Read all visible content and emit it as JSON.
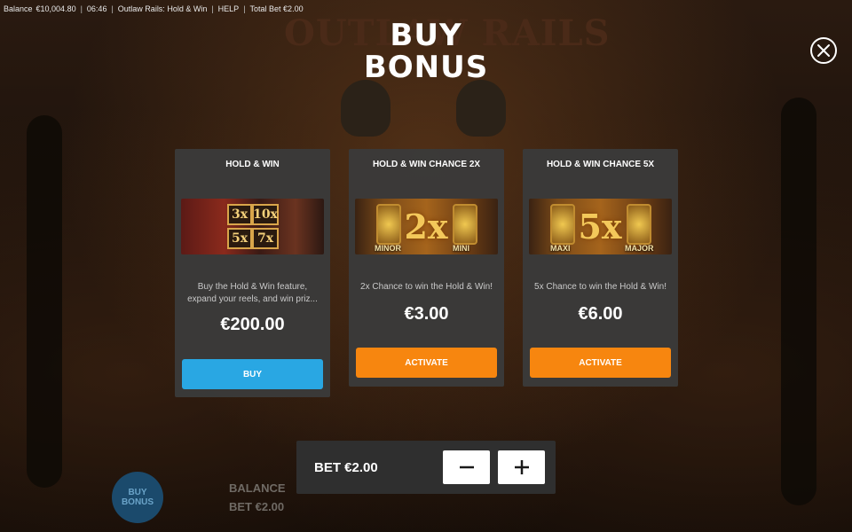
{
  "status_bar": {
    "balance_label": "Balance",
    "balance_value": "€10,004.80",
    "time": "06:46",
    "game_name": "Outlaw Rails: Hold & Win",
    "help": "HELP",
    "total_bet": "Total Bet €2.00"
  },
  "background": {
    "logo_text": "OUTLAW RAILS",
    "buy_bonus_btn": "BUY BONUS",
    "balance_label": "BALANCE",
    "bet_text": "BET €2.00"
  },
  "modal": {
    "title_line1": "BUY",
    "title_line2": "BONUS",
    "close_icon": "close-icon"
  },
  "cards": [
    {
      "title": "HOLD & WIN",
      "art_tiles": [
        "3x",
        "10x",
        "5x",
        "7x"
      ],
      "description": "Buy the Hold & Win feature, expand your reels, and win priz...",
      "price": "€200.00",
      "button": "BUY"
    },
    {
      "title": "HOLD & WIN CHANCE 2X",
      "art_multiplier": "2x",
      "art_labels": [
        "MINOR",
        "MINI"
      ],
      "description": "2x Chance to win the Hold & Win!",
      "price": "€3.00",
      "button": "ACTIVATE"
    },
    {
      "title": "HOLD & WIN CHANCE 5X",
      "art_multiplier": "5x",
      "art_labels": [
        "MAXI",
        "MAJOR"
      ],
      "description": "5x Chance to win the Hold & Win!",
      "price": "€6.00",
      "button": "ACTIVATE"
    }
  ],
  "bet_panel": {
    "label": "BET €2.00",
    "minus_icon": "minus-icon",
    "plus_icon": "plus-icon"
  },
  "colors": {
    "buy_button": "#29a7e3",
    "activate_button": "#f7860f",
    "card_bg": "#3a3a3a"
  }
}
